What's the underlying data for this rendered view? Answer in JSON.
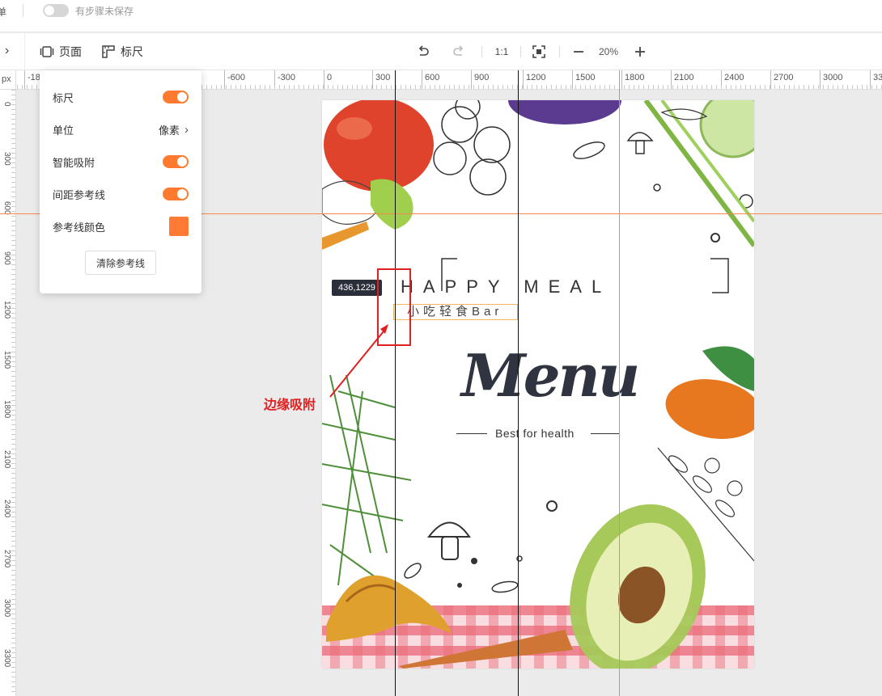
{
  "topbar": {
    "cut_label": "单",
    "save_status": "有步骤未保存"
  },
  "toolbar": {
    "page_label": "页面",
    "ruler_label": "标尺",
    "ratio_label": "1:1",
    "zoom_value": "20%"
  },
  "ruler": {
    "unit": "px",
    "h_labels": [
      "-18",
      "-600",
      "-300",
      "0",
      "300",
      "600",
      "900",
      "1200",
      "1500",
      "1800",
      "2100",
      "2400",
      "2700",
      "3000",
      "33"
    ],
    "v_labels": [
      "0",
      "300",
      "600",
      "900",
      "1200",
      "1500",
      "1800",
      "2100",
      "2400",
      "2700",
      "3000",
      "3300"
    ]
  },
  "panel": {
    "ruler": "标尺",
    "unit": "单位",
    "unit_value": "像素",
    "smart_snap": "智能吸附",
    "spacing_guides": "间距参考线",
    "guide_color": "参考线颜色",
    "clear_guides": "清除参考线",
    "colors": {
      "accent": "#ff7a2f",
      "guide": "#ff7a35"
    }
  },
  "coord_tooltip": "436,1229",
  "annotation": "边缘吸附",
  "poster": {
    "headline": "HAPPY MEAL",
    "subtitle_cn": "小吃轻食Bar",
    "menu": "Menu",
    "tagline": "Best for health"
  }
}
